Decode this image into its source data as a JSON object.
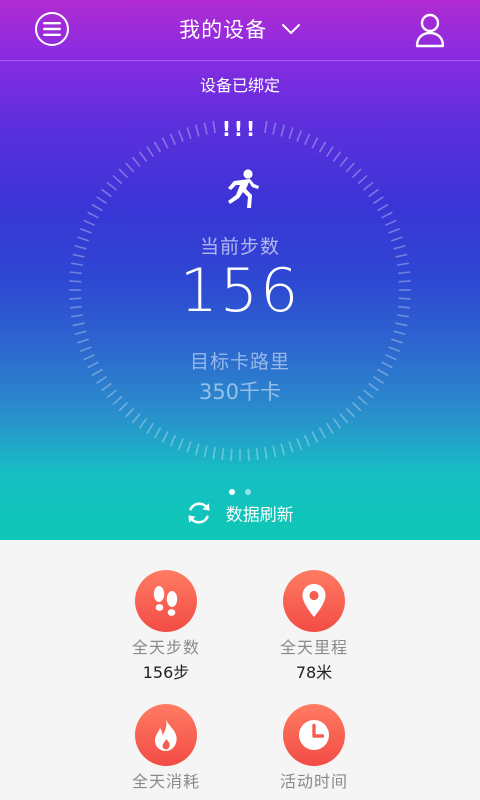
{
  "header": {
    "title": "我的设备",
    "menu_icon": "menu-icon",
    "dropdown_icon": "chevron-down-icon",
    "user_icon": "user-icon"
  },
  "device": {
    "status": "设备已绑定"
  },
  "dial": {
    "top_mark": "!!!",
    "activity_icon": "running-icon",
    "steps_label": "当前步数",
    "steps_value": "156",
    "calorie_label": "目标卡路里",
    "calorie_value": "350千卡"
  },
  "pager": {
    "count": 2,
    "active_index": 0
  },
  "refresh": {
    "label": "数据刷新",
    "icon": "refresh-icon"
  },
  "stats": [
    {
      "label": "全天步数",
      "value": "156步",
      "icon": "footprints-icon"
    },
    {
      "label": "全天里程",
      "value": "78米",
      "icon": "location-pin-icon"
    },
    {
      "label": "全天消耗",
      "value": "",
      "icon": "flame-icon"
    },
    {
      "label": "活动时间",
      "value": "",
      "icon": "clock-icon"
    }
  ],
  "colors": {
    "gradient_top": "#b12bd0",
    "gradient_mid": "#3a35d6",
    "gradient_bottom": "#0dc7b4",
    "stat_accent": "#f24c45",
    "panel_background": "#f5f5f5"
  }
}
